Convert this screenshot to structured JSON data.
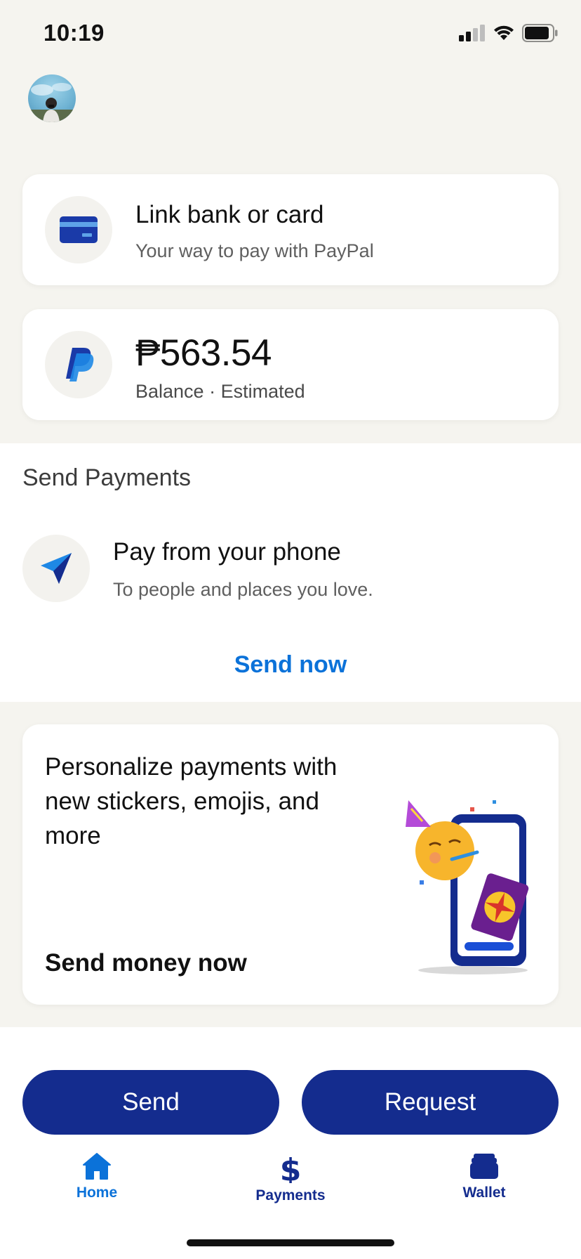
{
  "status_bar": {
    "time": "10:19"
  },
  "cards": {
    "link_bank": {
      "title": "Link bank or card",
      "subtitle": "Your way to pay with PayPal",
      "icon": "credit-card-icon"
    },
    "balance": {
      "amount": "₱563.54",
      "subtitle": "Balance · Estimated",
      "icon": "paypal-logo-icon"
    }
  },
  "send_payments": {
    "heading": "Send Payments",
    "item_title": "Pay from your phone",
    "item_subtitle": "To people and places you love.",
    "link": "Send now",
    "icon": "paper-plane-icon"
  },
  "promo": {
    "text": "Personalize payments with new stickers, emojis, and more",
    "cta": "Send money now"
  },
  "actions": {
    "send": "Send",
    "request": "Request"
  },
  "tab_bar": {
    "home": "Home",
    "payments": "Payments",
    "wallet": "Wallet",
    "active": "home"
  },
  "colors": {
    "brand_navy": "#142c8e",
    "link_blue": "#0b72d9",
    "background": "#f5f4ef"
  }
}
